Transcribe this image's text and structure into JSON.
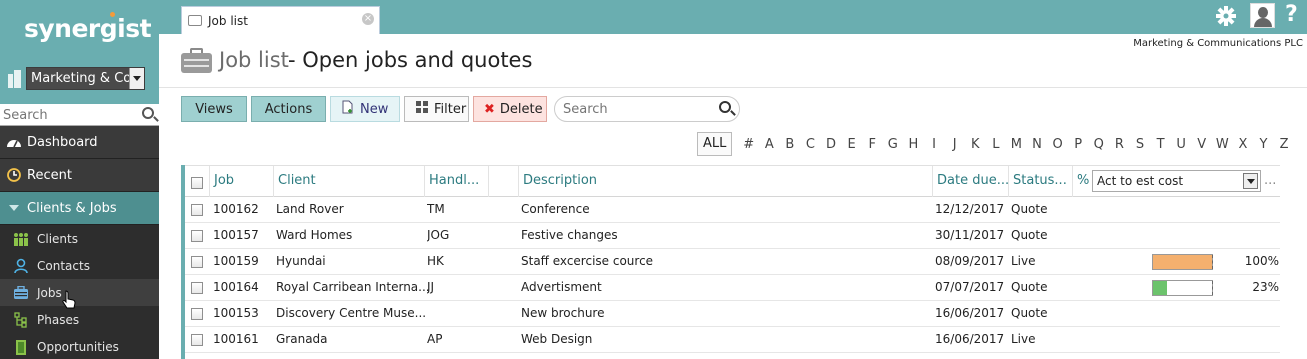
{
  "sidebar": {
    "logo": "synergist",
    "company_select": "Marketing & Cor",
    "search_placeholder": "Search",
    "nav": [
      {
        "label": "Dashboard"
      },
      {
        "label": "Recent"
      },
      {
        "label": "Clients & Jobs"
      }
    ],
    "sub": [
      {
        "label": "Clients"
      },
      {
        "label": "Contacts"
      },
      {
        "label": "Jobs"
      },
      {
        "label": "Phases"
      },
      {
        "label": "Opportunities"
      }
    ]
  },
  "topbar": {
    "tab_label": "Job list",
    "close_icon": "×"
  },
  "header": {
    "title": "Job list",
    "subtitle": "- Open jobs and quotes",
    "company": "Marketing & Communications PLC"
  },
  "toolbar": {
    "views": "Views",
    "actions": "Actions",
    "new": "New",
    "filter": "Filter",
    "delete": "Delete",
    "search_placeholder": "Search"
  },
  "alphabet": {
    "all": "ALL",
    "letters": [
      "#",
      "A",
      "B",
      "C",
      "D",
      "E",
      "F",
      "G",
      "H",
      "I",
      "J",
      "K",
      "L",
      "M",
      "N",
      "O",
      "P",
      "Q",
      "R",
      "S",
      "T",
      "U",
      "V",
      "W",
      "X",
      "Y",
      "Z"
    ]
  },
  "table": {
    "headers": {
      "job": "Job",
      "client": "Client",
      "handler": "Handl...",
      "description": "Description",
      "date_due": "Date due...",
      "status": "Status...",
      "percent": "%",
      "measure_select": "Act to est cost",
      "more": "..."
    },
    "rows": [
      {
        "job": "100162",
        "client": "Land Rover",
        "handler": "TM",
        "description": "Conference",
        "date": "12/12/2017",
        "status": "Quote",
        "pct": "",
        "progress": null
      },
      {
        "job": "100157",
        "client": "Ward Homes",
        "handler": "JOG",
        "description": "Festive changes",
        "date": "30/11/2017",
        "status": "Quote",
        "pct": "",
        "progress": null
      },
      {
        "job": "100159",
        "client": "Hyundai",
        "handler": "HK",
        "description": "Staff excercise cource",
        "date": "08/09/2017",
        "status": "Live",
        "pct": "100%",
        "progress": 1.0
      },
      {
        "job": "100164",
        "client": "Royal Carribean Interna...",
        "handler": "JJ",
        "description": "Advertisment",
        "date": "07/07/2017",
        "status": "Quote",
        "pct": "23%",
        "progress": 0.23
      },
      {
        "job": "100153",
        "client": "Discovery Centre Muse...",
        "handler": "",
        "description": "New brochure",
        "date": "16/06/2017",
        "status": "Quote",
        "pct": "",
        "progress": null
      },
      {
        "job": "100161",
        "client": "Granada",
        "handler": "AP",
        "description": "Web Design",
        "date": "16/06/2017",
        "status": "Live",
        "pct": "",
        "progress": null
      }
    ]
  },
  "colors": {
    "accent": "#6aaeb0",
    "progress_over": "#f4b06e",
    "progress_ok": "#6cc36c"
  }
}
